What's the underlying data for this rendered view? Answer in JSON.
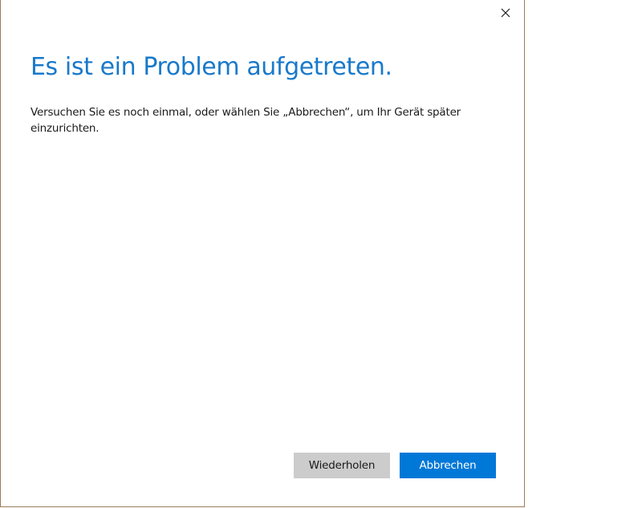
{
  "window": {
    "close_icon": "close-icon"
  },
  "dialog": {
    "title": "Es ist ein Problem aufgetreten.",
    "message": "Versuchen Sie es noch einmal, oder wählen Sie „Abbrechen“, um Ihr Gerät später einzurichten."
  },
  "buttons": {
    "retry_label": "Wiederholen",
    "cancel_label": "Abbrechen"
  },
  "colors": {
    "title": "#1979ca",
    "primary_button": "#0078d7",
    "secondary_button": "#cccccc",
    "border": "#9b7b5b"
  }
}
